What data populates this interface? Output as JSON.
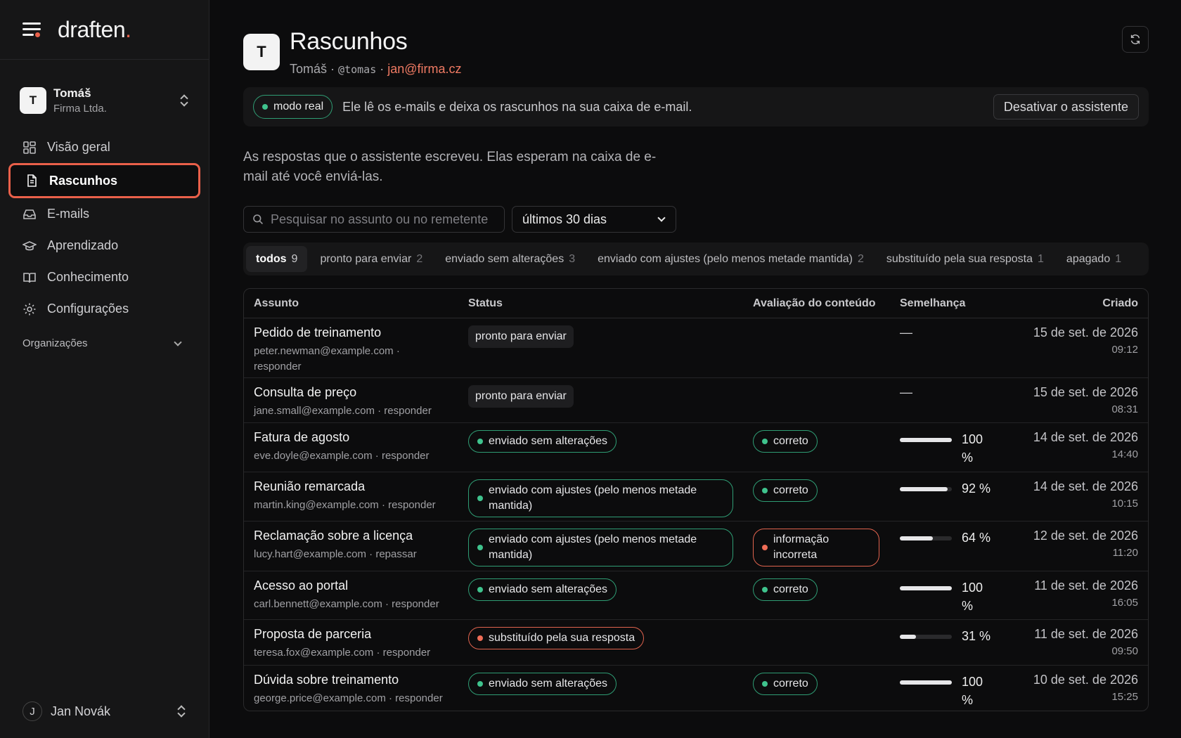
{
  "app": {
    "logo": "draften",
    "logo_dot": "."
  },
  "account": {
    "initial": "T",
    "name": "Tomáš",
    "org": "Firma Ltda."
  },
  "nav": [
    {
      "label": "Visão geral",
      "icon": "grid-icon"
    },
    {
      "label": "Rascunhos",
      "icon": "document-icon"
    },
    {
      "label": "E-mails",
      "icon": "inbox-icon"
    },
    {
      "label": "Aprendizado",
      "icon": "graduation-cap-icon"
    },
    {
      "label": "Conhecimento",
      "icon": "book-icon"
    },
    {
      "label": "Configurações",
      "icon": "gear-icon"
    }
  ],
  "organizations_label": "Organizações",
  "user": {
    "initial": "J",
    "name": "Jan Novák"
  },
  "header": {
    "initial": "T",
    "title": "Rascunhos",
    "name": "Tomáš",
    "sep": "·",
    "handle": "@tomas",
    "email": "jan@firma.cz"
  },
  "mode": {
    "badge": "modo real",
    "text": "Ele lê os e-mails e deixa os rascunhos na sua caixa de e-mail.",
    "button": "Desativar o assistente"
  },
  "description": "As respostas que o assistente escreveu. Elas esperam na caixa de e-mail até você enviá-las.",
  "search": {
    "placeholder": "Pesquisar no assunto ou no remetente"
  },
  "period": {
    "selected": "últimos 30 dias"
  },
  "tabs": [
    {
      "label": "todos",
      "count": "9"
    },
    {
      "label": "pronto para enviar",
      "count": "2"
    },
    {
      "label": "enviado sem alterações",
      "count": "3"
    },
    {
      "label": "enviado com ajustes (pelo menos metade mantida)",
      "count": "2"
    },
    {
      "label": "substituído pela sua resposta",
      "count": "1"
    },
    {
      "label": "apagado",
      "count": "1"
    }
  ],
  "table": {
    "columns": [
      "Assunto",
      "Status",
      "Avaliação do conteúdo",
      "Semelhança",
      "Criado"
    ],
    "rows": [
      {
        "subject": "Pedido de treinamento",
        "meta": "peter.newman@example.com · responder",
        "status": "pronto para enviar",
        "status_kind": "neutral",
        "rating": "",
        "rating_kind": "",
        "similarity": "—",
        "similarity_value": null,
        "date": "15 de set. de 2026",
        "time": "09:12"
      },
      {
        "subject": "Consulta de preço",
        "meta": "jane.small@example.com · responder",
        "status": "pronto para enviar",
        "status_kind": "neutral",
        "rating": "",
        "rating_kind": "",
        "similarity": "—",
        "similarity_value": null,
        "date": "15 de set. de 2026",
        "time": "08:31"
      },
      {
        "subject": "Fatura de agosto",
        "meta": "eve.doyle@example.com · responder",
        "status": "enviado sem alterações",
        "status_kind": "green",
        "rating": "correto",
        "rating_kind": "green",
        "similarity": "100 %",
        "similarity_value": 100,
        "date": "14 de set. de 2026",
        "time": "14:40"
      },
      {
        "subject": "Reunião remarcada",
        "meta": "martin.king@example.com · responder",
        "status": "enviado com ajustes (pelo menos metade mantida)",
        "status_kind": "green",
        "rating": "correto",
        "rating_kind": "green",
        "similarity": "92 %",
        "similarity_value": 92,
        "date": "14 de set. de 2026",
        "time": "10:15"
      },
      {
        "subject": "Reclamação sobre a licença",
        "meta": "lucy.hart@example.com · repassar",
        "status": "enviado com ajustes (pelo menos metade mantida)",
        "status_kind": "green",
        "rating": "informação incorreta",
        "rating_kind": "red",
        "similarity": "64 %",
        "similarity_value": 64,
        "date": "12 de set. de 2026",
        "time": "11:20"
      },
      {
        "subject": "Acesso ao portal",
        "meta": "carl.bennett@example.com · responder",
        "status": "enviado sem alterações",
        "status_kind": "green",
        "rating": "correto",
        "rating_kind": "green",
        "similarity": "100 %",
        "similarity_value": 100,
        "date": "11 de set. de 2026",
        "time": "16:05"
      },
      {
        "subject": "Proposta de parceria",
        "meta": "teresa.fox@example.com · responder",
        "status": "substituído pela sua resposta",
        "status_kind": "red",
        "rating": "",
        "rating_kind": "",
        "similarity": "31 %",
        "similarity_value": 31,
        "date": "11 de set. de 2026",
        "time": "09:50"
      },
      {
        "subject": "Dúvida sobre treinamento",
        "meta": "george.price@example.com · responder",
        "status": "enviado sem alterações",
        "status_kind": "green",
        "rating": "correto",
        "rating_kind": "green",
        "similarity": "100 %",
        "similarity_value": 100,
        "date": "10 de set. de 2026",
        "time": "15:25"
      }
    ]
  },
  "colors": {
    "accent": "#e9604a",
    "success": "#3fc38d",
    "background": "#0c0c0d",
    "sidebar": "#161617"
  }
}
